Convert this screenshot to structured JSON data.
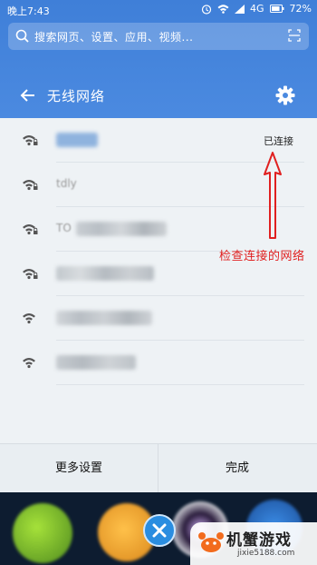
{
  "status_bar": {
    "time": "晚上7:43",
    "network": "4G",
    "battery": "72%"
  },
  "search": {
    "placeholder": "搜索网页、设置、应用、视频..."
  },
  "header": {
    "title": "无线网络"
  },
  "networks": [
    {
      "name": "",
      "status": "已连接",
      "secured": true
    },
    {
      "name": "tdly",
      "status": "",
      "secured": true
    },
    {
      "name": "TO",
      "status": "",
      "secured": true
    },
    {
      "name": "",
      "status": "",
      "secured": true
    },
    {
      "name": "",
      "status": "",
      "secured": false
    },
    {
      "name": "",
      "status": "",
      "secured": false
    }
  ],
  "footer": {
    "more_settings": "更多设置",
    "done": "完成"
  },
  "annotation": {
    "text": "检查连接的网络",
    "color": "#e02020"
  },
  "watermark": {
    "brand": "机蟹游戏",
    "url": "jixie5188.com"
  },
  "colors": {
    "header_blue": "#4b8ae0",
    "panel_bg": "#eef2f5",
    "accent_blue": "#2a8de0"
  }
}
